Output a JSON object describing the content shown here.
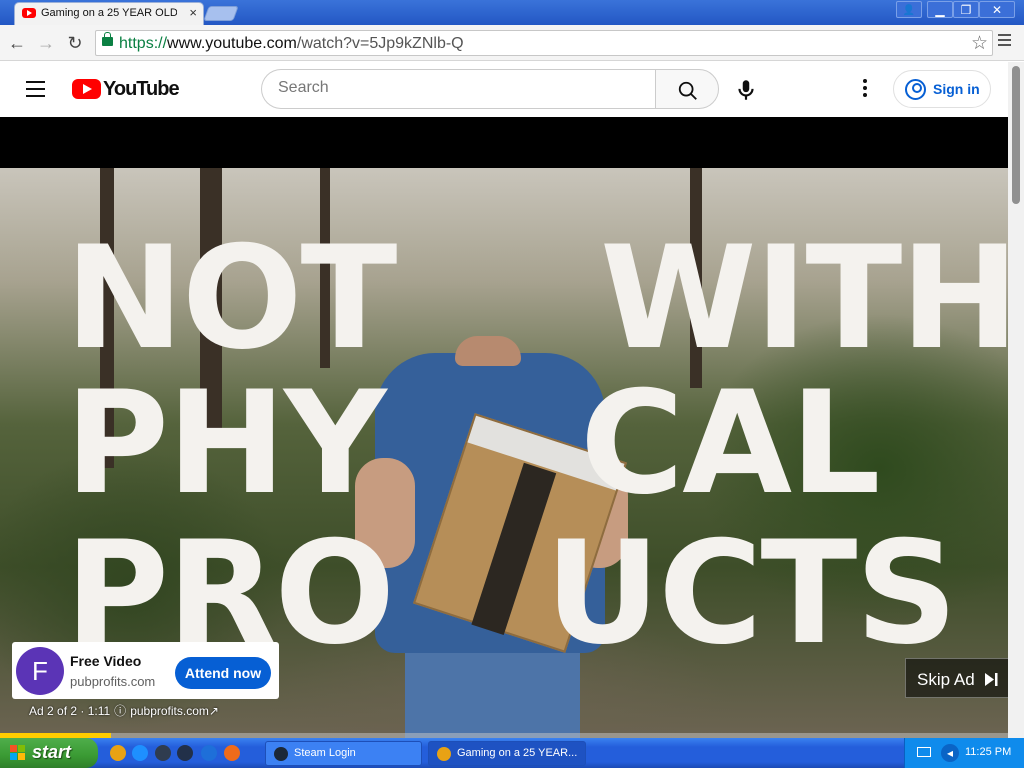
{
  "browser": {
    "tab_title": "Gaming on a 25 YEAR OLD",
    "url_scheme": "https://",
    "url_host": "www.youtube.com",
    "url_path": "/watch?v=5Jp9kZNlb-Q",
    "controls": {
      "back": "←",
      "forward": "→",
      "reload": "↻",
      "close_tab": "×",
      "star": "☆",
      "minimize": "▁",
      "restore": "❐",
      "close": "✕",
      "user": "👤"
    }
  },
  "youtube": {
    "logo_text": "YouTube",
    "search_placeholder": "Search",
    "signin_label": "Sign in",
    "accent_color": "#ff0000",
    "link_color": "#065fd4"
  },
  "video": {
    "overlay_lines": [
      "NOT",
      "WITH",
      "PHY",
      "CAL",
      "PRO",
      "UCTS"
    ],
    "ad": {
      "avatar_letter": "F",
      "title": "Free Video",
      "domain": "pubprofits.com",
      "cta_label": "Attend now",
      "counter": "Ad 2 of 2 · 1:11",
      "info_icon": "ⓘ",
      "link": "pubprofits.com",
      "external_icon": "↗"
    },
    "skip_label": "Skip Ad",
    "progress_fraction": 0.11
  },
  "taskbar": {
    "start_label": "start",
    "items": [
      {
        "label": "Steam Login",
        "icon_color": "#1b2838"
      },
      {
        "label": "Gaming on a 25 YEAR...",
        "icon_color": "#e8a214"
      }
    ],
    "quick_launch_colors": [
      "#e8a214",
      "#1e90ff",
      "#2f3c4f",
      "#223049",
      "#1e6fd9",
      "#ef6b1b"
    ],
    "clock": "11:25 PM"
  }
}
